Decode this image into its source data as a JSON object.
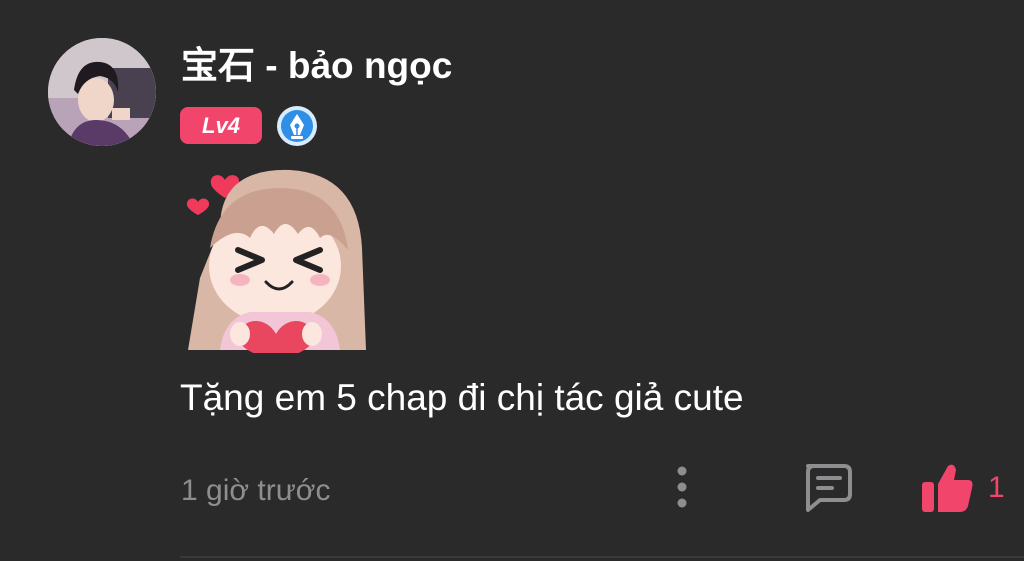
{
  "comment": {
    "username": "宝石 - bảo ngọc",
    "level_badge": "Lv4",
    "text": "Tặng em 5 chap đi chị tác giả cute",
    "timestamp": "1 giờ trước",
    "like_count": "1"
  },
  "icons": {
    "avatar": "user-avatar",
    "badge": "pen-nib-badge-icon",
    "sticker": "cute-girl-heart-sticker",
    "more": "more-vertical-icon",
    "reply": "comment-reply-icon",
    "like": "thumbs-up-icon"
  },
  "colors": {
    "background": "#2a2a2b",
    "accent": "#f2456b",
    "muted_text": "#8e8e90",
    "icon_gray": "#8e8e90",
    "badge_blue": "#2f8fe6"
  }
}
